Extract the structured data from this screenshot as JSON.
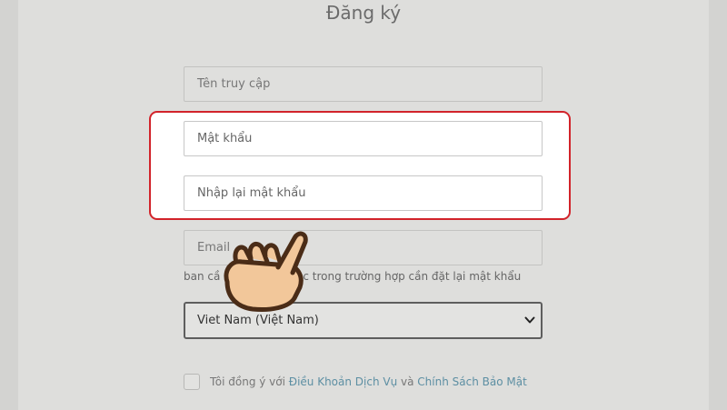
{
  "form": {
    "title": "Đăng ký",
    "username_placeholder": "Tên truy cập",
    "password_placeholder": "Mật khẩu",
    "confirm_password_placeholder": "Nhập lại mật khẩu",
    "email_placeholder": "Email",
    "email_helper_visible_start": "ban cầ",
    "email_helper_visible_end": "c trong trường hợp cần đặt lại mật khẩu",
    "country_selected": "Viet Nam (Việt Nam)",
    "agree_prefix": "Tôi đồng ý với ",
    "terms_link": "Điều Khoản Dịch Vụ",
    "agree_and": " và ",
    "privacy_link": "Chính Sách Bảo Mật"
  },
  "colors": {
    "highlight_border": "#d2232a",
    "link": "#5d8fa3",
    "overlay_bg": "#dededc"
  },
  "icons": {
    "pointer": "pointing-hand-icon",
    "dropdown": "chevron-down-icon"
  }
}
